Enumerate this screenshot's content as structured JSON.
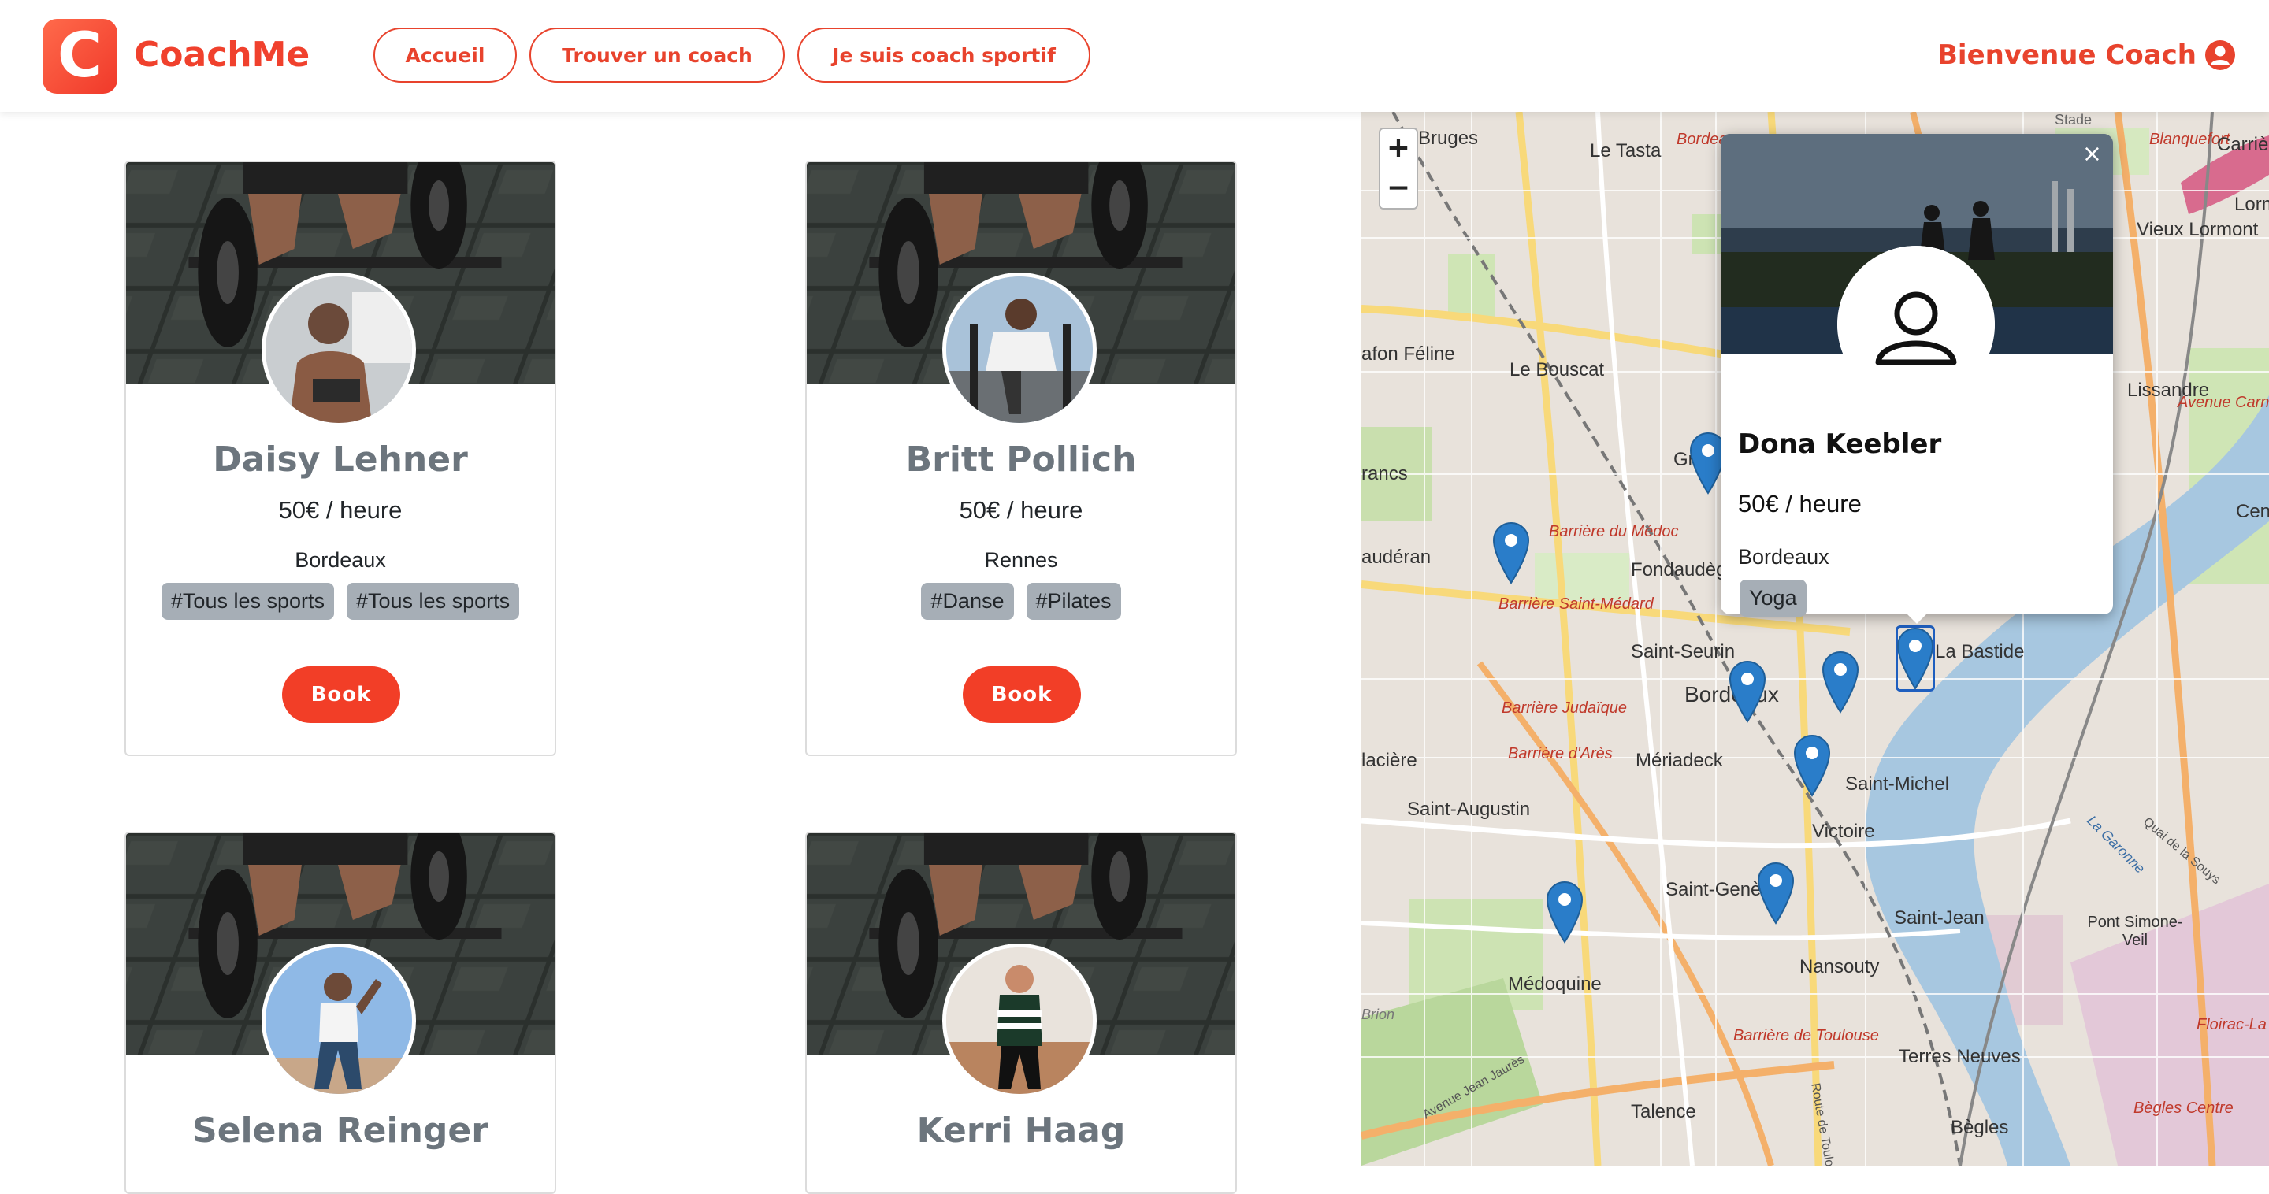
{
  "header": {
    "logo_letter": "C",
    "brand": "CoachMe",
    "nav": [
      "Accueil",
      "Trouver un coach",
      "Je suis coach sportif"
    ],
    "welcome": "Bienvenue Coach"
  },
  "coaches": [
    {
      "name": "Daisy Lehner",
      "price": "50€ / heure",
      "city": "Bordeaux",
      "tags": [
        "#Tous les sports",
        "#Tous les sports"
      ],
      "book": "Book"
    },
    {
      "name": "Britt Pollich",
      "price": "50€ / heure",
      "city": "Rennes",
      "tags": [
        "#Danse",
        "#Pilates"
      ],
      "book": "Book"
    },
    {
      "name": "Selena Reinger"
    },
    {
      "name": "Kerri Haag"
    }
  ],
  "map": {
    "zoom_in": "+",
    "zoom_out": "−",
    "labels": [
      "Bruges",
      "Le Tasta",
      "Bordeaux",
      "Blanquefort",
      "Carrière",
      "Vieux Lormont",
      "Lorm",
      "afon Féline",
      "Le Bouscat",
      "Lissandre",
      "rancs",
      "Avenue Carnot",
      "Ceno",
      "audéran",
      "Barrière du Médoc",
      "Fondaudège",
      "Barrière Saint-Médard",
      "Saint-Seurin",
      "La Bastide",
      "Bordeaux",
      "Barrière Judaïque",
      "Barrière d'Arès",
      "Mériadeck",
      "lacière",
      "Saint-Augustin",
      "Saint-Michel",
      "Victoire",
      "Saint-Genès",
      "Saint-Jean",
      "Pont Simone-Veil",
      "Nansouty",
      "Médoquine",
      "Barrière de Toulouse",
      "Terres Neuves",
      "Talence",
      "Bègles",
      "Bègles Centre",
      "Floirac-La Souys",
      "Stade",
      "La Garonne",
      "Quai de la Souys",
      "Avenue Jean Jaurès",
      "Route de Toulouse",
      "Gr",
      "Brion"
    ],
    "popup": {
      "close": "×",
      "name": "Dona Keebler",
      "price": "50€ / heure",
      "city": "Bordeaux",
      "tag": "Yoga"
    }
  },
  "colors": {
    "brand": "#f0412d",
    "button": "#f23e27",
    "tag": "#a6aeb6",
    "name": "#6c757d",
    "marker": "#2a7dc9"
  }
}
